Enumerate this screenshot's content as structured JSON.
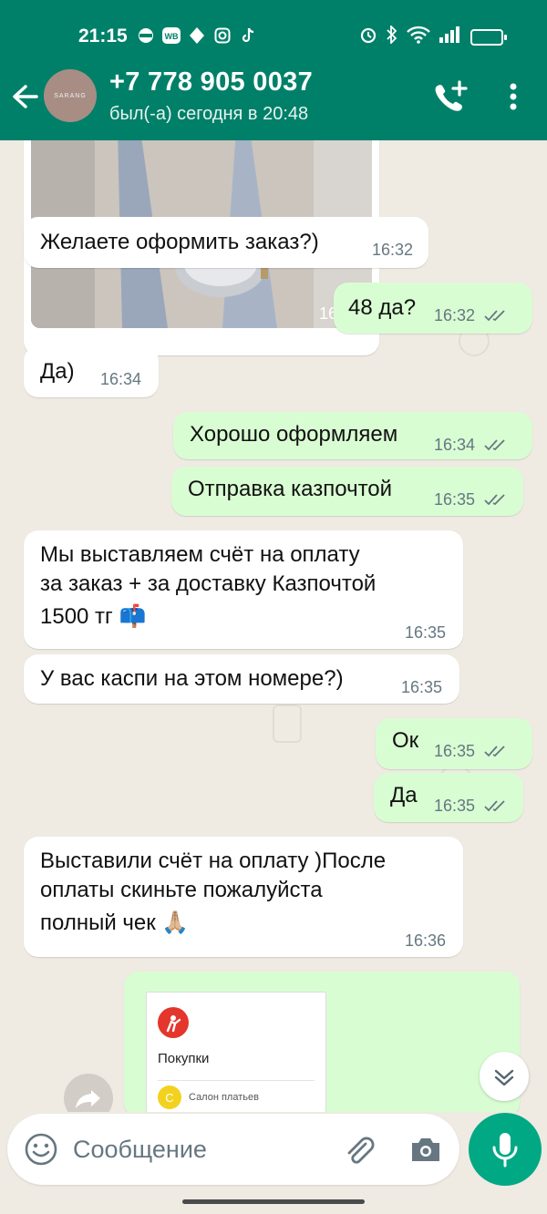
{
  "status_bar": {
    "time": "21:15",
    "left_icons": [
      "ninja-icon",
      "wb-icon",
      "diamond-icon",
      "instagram-icon",
      "tiktok-icon"
    ],
    "right_icons": [
      "alarm-icon",
      "bluetooth-icon",
      "wifi-icon",
      "signal-icon",
      "battery-icon"
    ]
  },
  "header": {
    "avatar_text": "SARANG",
    "contact_name": "+7 778 905 0037",
    "last_seen": "был(-а) сегодня в 20:48",
    "colors": {
      "bar": "#008069"
    }
  },
  "messages": [
    {
      "dir": "in",
      "type": "image",
      "time": "16:32"
    },
    {
      "dir": "in",
      "lines": [
        "Желаете оформить заказ?)"
      ],
      "time": "16:32"
    },
    {
      "dir": "out",
      "lines": [
        "48 да?"
      ],
      "time": "16:32",
      "read": true
    },
    {
      "dir": "in",
      "lines": [
        "Да)"
      ],
      "time": "16:34"
    },
    {
      "dir": "out",
      "lines": [
        "Хорошо оформляем"
      ],
      "time": "16:34",
      "read": true
    },
    {
      "dir": "out",
      "lines": [
        "Отправка казпочтой"
      ],
      "time": "16:35",
      "read": true
    },
    {
      "dir": "in",
      "lines": [
        "Мы выставляем счёт на оплату",
        "за заказ + за доставку Казпочтой",
        "1500 тг 📫"
      ],
      "time": "16:35"
    },
    {
      "dir": "in",
      "lines": [
        "У вас каспи на этом номере?)"
      ],
      "time": "16:35"
    },
    {
      "dir": "out",
      "lines": [
        "Ок"
      ],
      "time": "16:35",
      "read": true
    },
    {
      "dir": "out",
      "lines": [
        "Да"
      ],
      "time": "16:35",
      "read": true
    },
    {
      "dir": "in",
      "lines": [
        "Выставили счёт на оплату )После",
        "оплаты скиньте пожалуйста",
        "полный чек 🙏🏼"
      ],
      "time": "16:36"
    }
  ],
  "receipt_card": {
    "title": "Покупки",
    "seller_initial": "С",
    "seller": "Салон платьев"
  },
  "composer": {
    "placeholder": "Сообщение"
  },
  "colors": {
    "incoming": "#ffffff",
    "outgoing": "#d9fdd3",
    "background": "#efeae2",
    "accent": "#00a884",
    "ticks": "#667781"
  }
}
